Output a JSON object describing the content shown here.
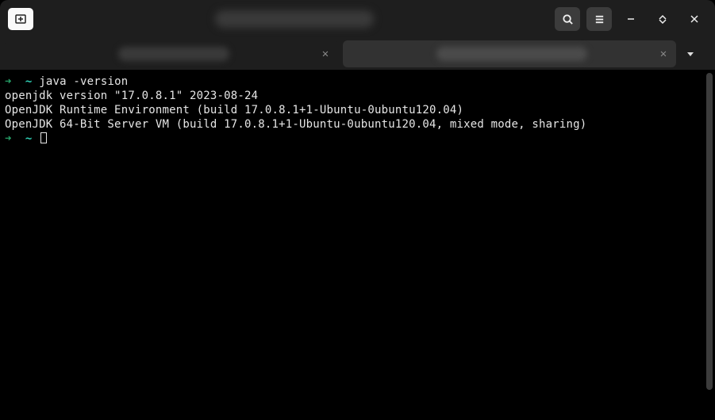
{
  "titlebar": {
    "title_hidden": true
  },
  "tabs": {
    "items": [
      {
        "active": false,
        "label_hidden": true
      },
      {
        "active": true,
        "label_hidden": true
      }
    ]
  },
  "terminal": {
    "prompt_arrow": "➜",
    "prompt_dir": "~",
    "command": "java -version",
    "output": [
      "openjdk version \"17.0.8.1\" 2023-08-24",
      "OpenJDK Runtime Environment (build 17.0.8.1+1-Ubuntu-0ubuntu120.04)",
      "OpenJDK 64-Bit Server VM (build 17.0.8.1+1-Ubuntu-0ubuntu120.04, mixed mode, sharing)"
    ]
  }
}
